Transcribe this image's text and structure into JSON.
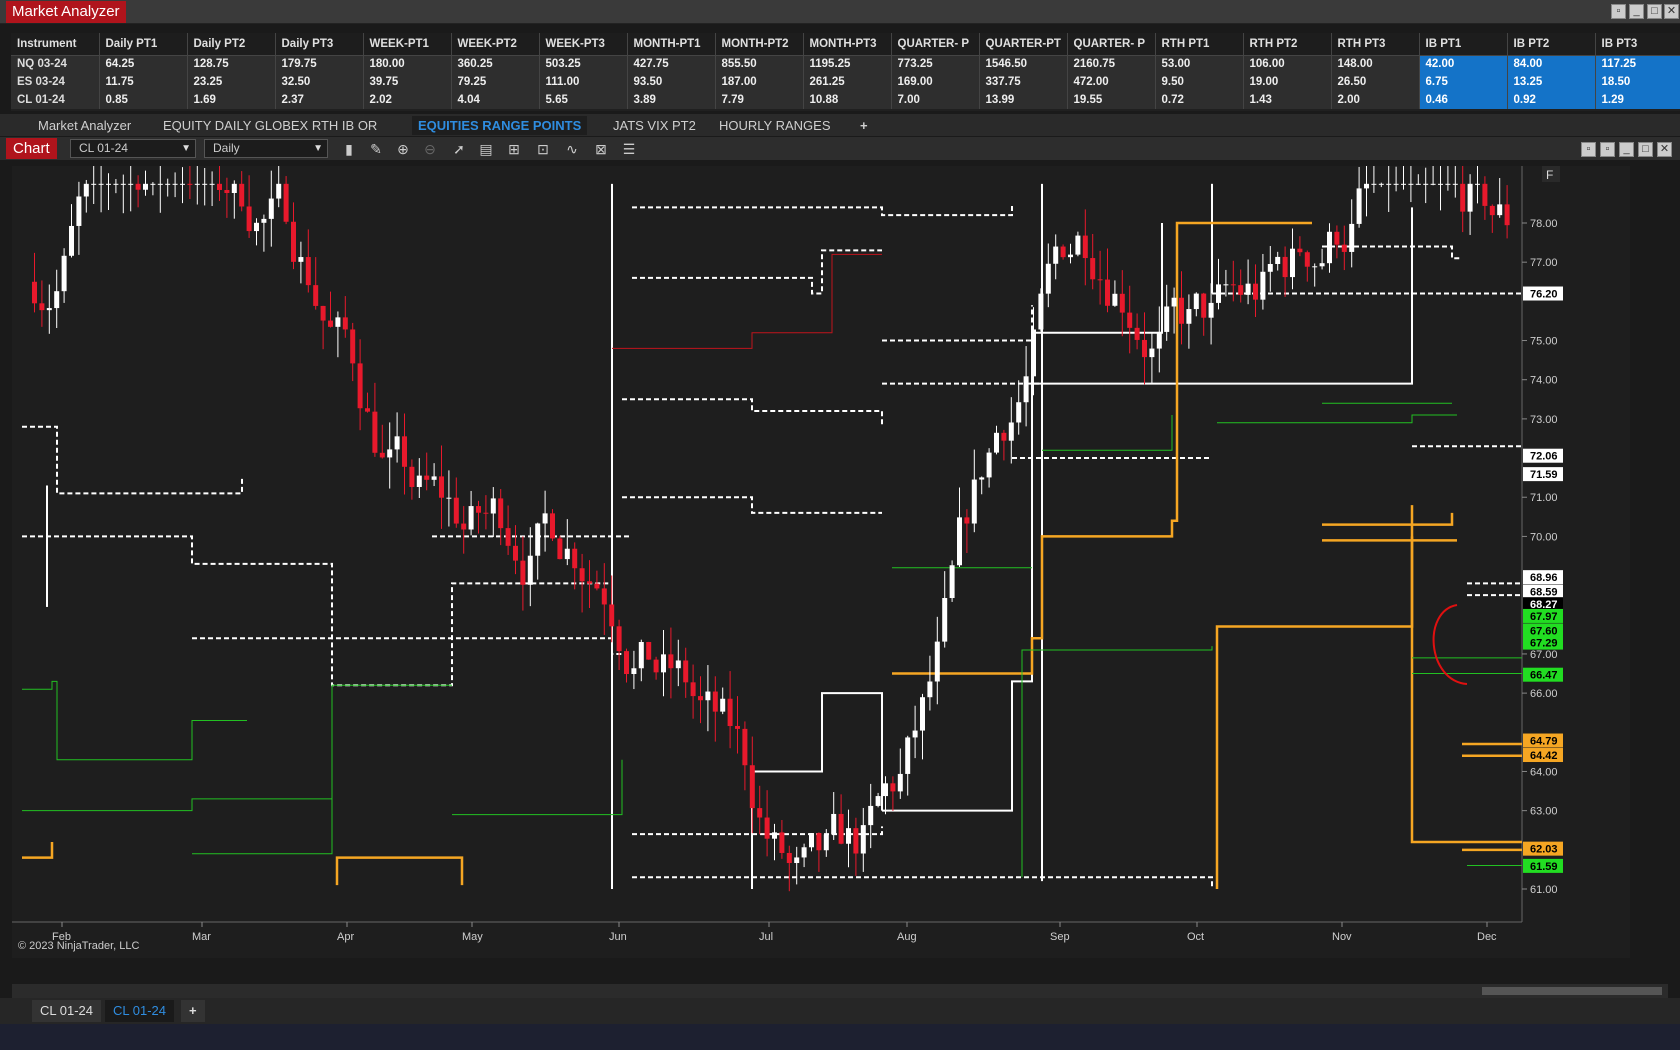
{
  "window": {
    "title": "Market Analyzer"
  },
  "market_analyzer": {
    "headers": [
      "Instrument",
      "Daily PT1",
      "Daily PT2",
      "Daily PT3",
      "WEEK-PT1",
      "WEEK-PT2",
      "WEEK-PT3",
      "MONTH-PT1",
      "MONTH-PT2",
      "MONTH-PT3",
      "QUARTER- P",
      "QUARTER-PT",
      "QUARTER- P",
      "RTH PT1",
      "RTH PT2",
      "RTH PT3",
      "IB PT1",
      "IB PT2",
      "IB PT3"
    ],
    "rows": [
      [
        "NQ 03-24",
        "64.25",
        "128.75",
        "179.75",
        "180.00",
        "360.25",
        "503.25",
        "427.75",
        "855.50",
        "1195.25",
        "773.25",
        "1546.50",
        "2160.75",
        "53.00",
        "106.00",
        "148.00",
        "42.00",
        "84.00",
        "117.25"
      ],
      [
        "ES 03-24",
        "11.75",
        "23.25",
        "32.50",
        "39.75",
        "79.25",
        "111.00",
        "93.50",
        "187.00",
        "261.25",
        "169.00",
        "337.75",
        "472.00",
        "9.50",
        "19.00",
        "26.50",
        "6.75",
        "13.25",
        "18.50"
      ],
      [
        "CL 01-24",
        "0.85",
        "1.69",
        "2.37",
        "2.02",
        "4.04",
        "5.65",
        "3.89",
        "7.79",
        "10.88",
        "7.00",
        "13.99",
        "19.55",
        "0.72",
        "1.43",
        "2.00",
        "0.46",
        "0.92",
        "1.29"
      ]
    ]
  },
  "tabs": [
    "Market Analyzer",
    "EQUITY DAILY GLOBEX RTH IB OR",
    "EQUITIES RANGE POINTS",
    "JATS VIX PT2",
    "HOURLY RANGES"
  ],
  "add_tab": "+",
  "chart_toolbar": {
    "label": "Chart",
    "instrument": "CL 01-24",
    "interval": "Daily"
  },
  "chart": {
    "corner": "F",
    "copyright": "© 2023 NinjaTrader, LLC",
    "months": [
      "Feb",
      "Mar",
      "Apr",
      "May",
      "Jun",
      "Jul",
      "Aug",
      "Sep",
      "Oct",
      "Nov",
      "Dec"
    ],
    "price_ticks": [
      "78.00",
      "77.00",
      "75.00",
      "74.00",
      "73.00",
      "71.00",
      "70.00",
      "67.00",
      "66.00",
      "64.00",
      "63.00",
      "61.00"
    ],
    "price_labels": [
      {
        "text": "76.20",
        "color": "#ffffff",
        "value": 76.2
      },
      {
        "text": "72.06",
        "color": "#ffffff",
        "value": 72.06
      },
      {
        "text": "71.59",
        "color": "#ffffff",
        "value": 71.59
      },
      {
        "text": "68.96",
        "color": "#ffffff",
        "value": 68.96
      },
      {
        "text": "68.59",
        "color": "#ffffff",
        "value": 68.59
      },
      {
        "text": "68.27",
        "color": "#000000",
        "value": 68.27
      },
      {
        "text": "67.97",
        "color": "#22dd22",
        "value": 67.97
      },
      {
        "text": "67.60",
        "color": "#22dd22",
        "value": 67.6
      },
      {
        "text": "67.29",
        "color": "#22dd22",
        "value": 67.29
      },
      {
        "text": "66.47",
        "color": "#22dd22",
        "value": 66.47
      },
      {
        "text": "64.79",
        "color": "#f5a623",
        "value": 64.79
      },
      {
        "text": "64.42",
        "color": "#f5a623",
        "value": 64.42
      },
      {
        "text": "62.03",
        "color": "#f5a623",
        "value": 62.03
      },
      {
        "text": "61.59",
        "color": "#22dd22",
        "value": 61.59
      }
    ]
  },
  "bottom_tabs": [
    "CL 01-24",
    "CL 01-24"
  ],
  "colors": {
    "up": "#ffffff",
    "down": "#e8192c",
    "orange": "#f5a623",
    "green": "#22c022",
    "red_title": "#b0141c",
    "ib_blue": "#1473c8"
  }
}
